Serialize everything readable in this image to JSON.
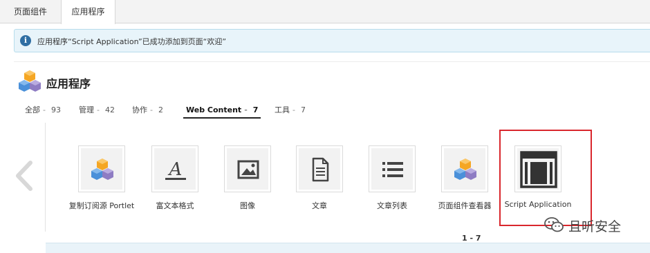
{
  "top_tabs": [
    {
      "label": "页面组件"
    },
    {
      "label": "应用程序"
    }
  ],
  "alert": {
    "message": "应用程序“Script Application”已成功添加到页面“欢迎”"
  },
  "header": {
    "title": "应用程序"
  },
  "categories": [
    {
      "label": "全部",
      "sep": "-",
      "count": "93"
    },
    {
      "label": "管理",
      "sep": "-",
      "count": "42"
    },
    {
      "label": "协作",
      "sep": "-",
      "count": "2"
    },
    {
      "label": "Web Content",
      "sep": "-",
      "count": "7",
      "active": true
    },
    {
      "label": "工具",
      "sep": "-",
      "count": "7"
    }
  ],
  "apps": [
    {
      "label": "复制订阅源 Portlet",
      "icon": "cubes-icon"
    },
    {
      "label": "富文本格式",
      "icon": "text-format-icon"
    },
    {
      "label": "图像",
      "icon": "image-icon"
    },
    {
      "label": "文章",
      "icon": "document-icon"
    },
    {
      "label": "文章列表",
      "icon": "list-icon"
    },
    {
      "label": "页面组件查看器",
      "icon": "cubes-icon"
    },
    {
      "label": "Script Application",
      "icon": "layout-frame-icon"
    }
  ],
  "pager": {
    "range": "1 - 7"
  },
  "watermark": {
    "text": "且听安全"
  },
  "colors": {
    "alert_bg": "#e8f4fa",
    "alert_icon": "#2f6ea3",
    "highlight": "#d9262c",
    "cube_orange": "#f5a623",
    "cube_blue": "#4a90d9",
    "cube_purple": "#8e7cc3"
  }
}
